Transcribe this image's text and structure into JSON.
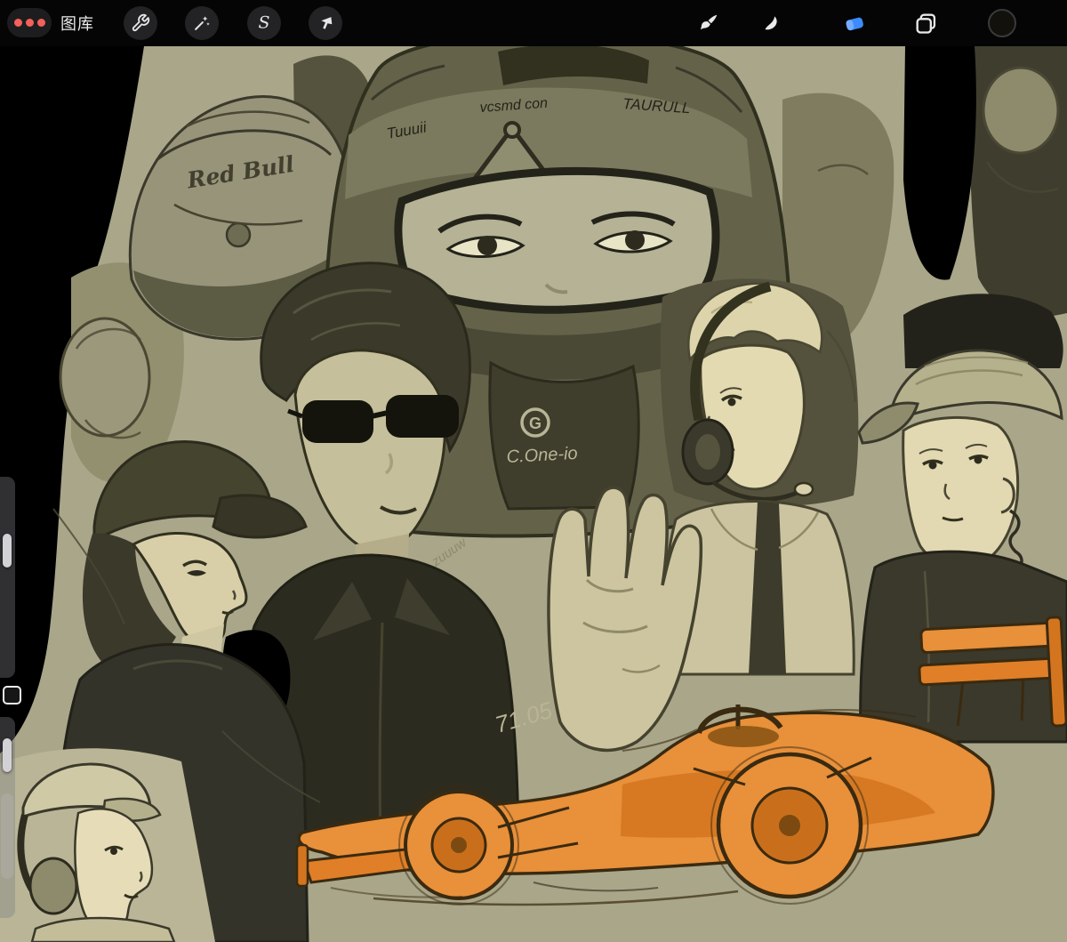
{
  "topbar": {
    "gallery_label": "图库",
    "window_dots": {
      "colors": [
        "#f4605a",
        "#f4605a",
        "#f4605a"
      ]
    },
    "left_tools": [
      {
        "id": "actions",
        "icon": "wrench-icon",
        "active": false
      },
      {
        "id": "adjustments",
        "icon": "magic-wand-icon",
        "active": false
      },
      {
        "id": "selection",
        "icon": "selection-s-icon",
        "glyph": "S",
        "active": false
      },
      {
        "id": "transform",
        "icon": "transform-arrow-icon",
        "active": false
      }
    ],
    "right_tools": [
      {
        "id": "paint",
        "icon": "paintbrush-icon",
        "active": false
      },
      {
        "id": "smudge",
        "icon": "smudge-icon",
        "active": false
      },
      {
        "id": "erase",
        "icon": "eraser-icon",
        "active": true,
        "active_color": "#3d8bfd"
      },
      {
        "id": "layers",
        "icon": "layers-icon",
        "active": false
      },
      {
        "id": "color",
        "icon": "color-swatch-icon",
        "current_color": "#12110b"
      }
    ]
  },
  "sidebar": {
    "size_slider": {
      "name": "brush-size",
      "handle_fraction_from_top": 0.34
    },
    "modify_button": {
      "name": "modify"
    },
    "opacity_slider": {
      "name": "brush-opacity",
      "handle_fraction_from_top": 0.13
    }
  },
  "canvas": {
    "background": "#000000",
    "paper_tone": "#a9a68a",
    "car_orange": "#e8903a",
    "artwork_texts": {
      "helmet_brand": "Red Bull",
      "visor_scribble_left": "Tuuuii",
      "visor_scribble_mid": "vcsmd con",
      "visor_scribble_right": "TAURULL",
      "suit_logo": "G",
      "suit_scribble": "C.One-io",
      "chest_scribble": "zuuuw",
      "number_scribble": "71.05"
    }
  }
}
